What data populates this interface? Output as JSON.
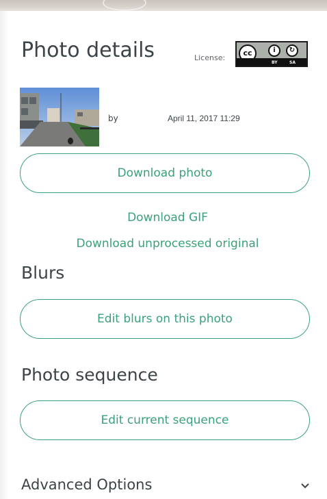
{
  "panel": {
    "title": "Photo details",
    "license_label": "License:",
    "license_badge": {
      "cc": "cc",
      "by": "BY",
      "sa": "SA"
    },
    "photo": {
      "by_text": "by",
      "date": "April 11, 2017 11:29"
    },
    "download_button": "Download photo",
    "download_gif": "Download GIF",
    "download_original": "Download unprocessed original",
    "blurs": {
      "heading": "Blurs",
      "button": "Edit blurs on this photo"
    },
    "sequence": {
      "heading": "Photo sequence",
      "button": "Edit current sequence"
    },
    "advanced": {
      "label": "Advanced Options",
      "icon": "chevron-down-icon"
    }
  },
  "colors": {
    "accent": "#3aa17a",
    "heading_text": "#3d4448",
    "background": "#ffffff"
  }
}
